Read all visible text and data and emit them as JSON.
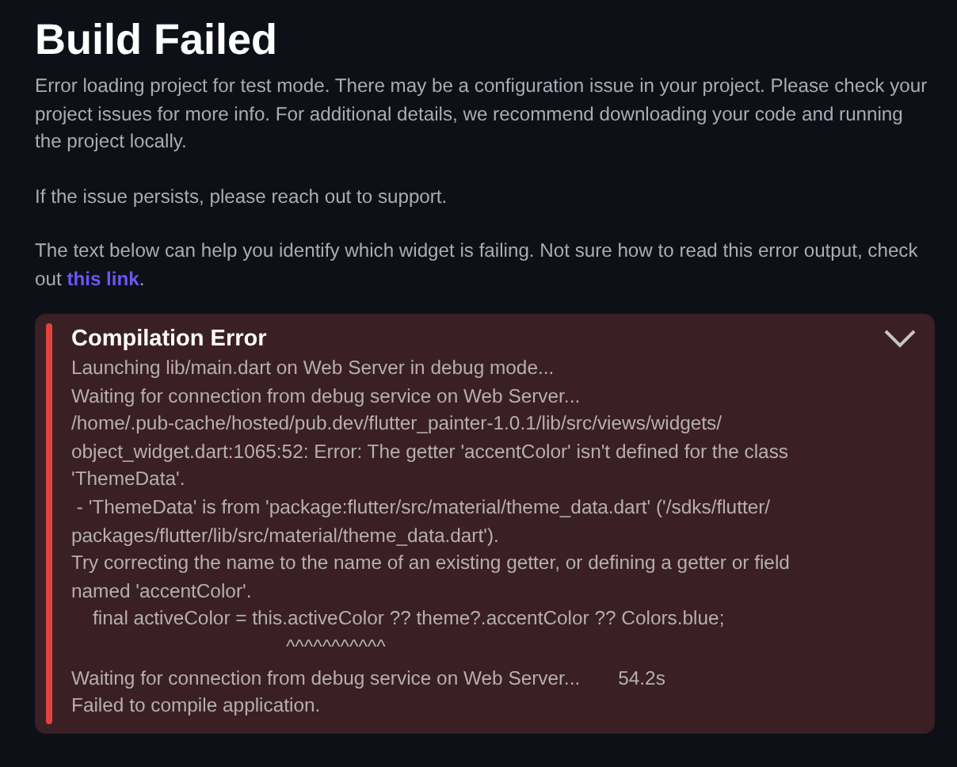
{
  "title": "Build Failed",
  "paragraphs": [
    {
      "text": "Error loading project for test mode. There may be a configuration issue in your project. Please check your project issues for more info. For additional details, we recommend downloading your code and running the project locally."
    },
    {
      "text": "If the issue persists, please reach out to support."
    },
    {
      "text": "The text below can help you identify which widget is failing. Not sure how to read this error output, check out ",
      "link": "this link",
      "after": "."
    }
  ],
  "error_panel": {
    "title": "Compilation Error",
    "expanded": true,
    "log_lines": [
      "Launching lib/main.dart on Web Server in debug mode...",
      "Waiting for connection from debug service on Web Server...",
      "/home/.pub-cache/hosted/pub.dev/flutter_painter-1.0.1/lib/src/views/widgets/",
      "object_widget.dart:1065:52: Error: The getter 'accentColor' isn't defined for the class",
      "'ThemeData'.",
      " - 'ThemeData' is from 'package:flutter/src/material/theme_data.dart' ('/sdks/flutter/",
      "packages/flutter/lib/src/material/theme_data.dart').",
      "Try correcting the name to the name of an existing getter, or defining a getter or field",
      "named 'accentColor'.",
      "    final activeColor = this.activeColor ?? theme?.accentColor ?? Colors.blue;",
      "                                        ^^^^^^^^^^^"
    ],
    "status": {
      "text": "Waiting for connection from debug service on Web Server...",
      "time": "54.2s"
    },
    "final_line": "Failed to compile application."
  }
}
